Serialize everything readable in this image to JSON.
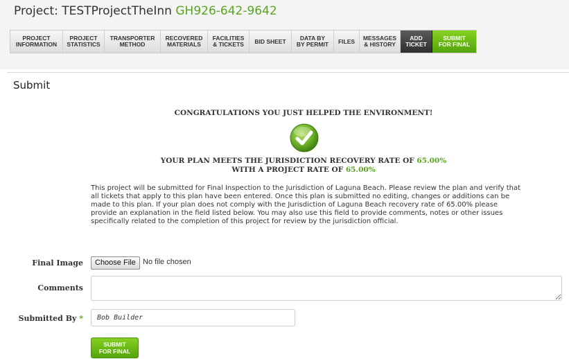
{
  "project": {
    "label": "Project: TESTProjectTheInn",
    "code": "GH926-642-9642"
  },
  "tabs": [
    {
      "label": "PROJECT\nINFORMATION"
    },
    {
      "label": "PROJECT\nSTATISTICS"
    },
    {
      "label": "TRANSPORTER\nMETHOD"
    },
    {
      "label": "RECOVERED\nMATERIALS"
    },
    {
      "label": "FACILITIES\n& TICKETS"
    },
    {
      "label": "BID SHEET"
    },
    {
      "label": "DATA BY\nBY PERMIT"
    },
    {
      "label": "FILES"
    },
    {
      "label": "MESSAGES\n& HISTORY"
    },
    {
      "label": "ADD\nTICKET"
    },
    {
      "label": "SUBMIT\nFOR FINAL"
    }
  ],
  "section": {
    "title": "Submit"
  },
  "message": {
    "congrats": "CONGRATULATIONS YOU JUST HELPED THE ENVIRONMENT!",
    "rate_line1_prefix": "YOUR PLAN MEETS THE JURISDICTION RECOVERY RATE OF",
    "rate_line1_value": "65.00%",
    "rate_line2_prefix": "WITH A PROJECT RATE OF",
    "rate_line2_value": "65.00%",
    "paragraph": "This project will be submitted for Final Inspection to the Jurisdiction of Laguna Beach. Please review the plan and verify that all tickets that apply to this plan have been entered. Once this plan is submitted no editing, changes or additions can be made to this plan. If your plan does not comply with the Jurisdiction of Laguna Beach recovery rate of 65.00% please provide an explanation in the field listed below. You may also use this field to provide comments, notes or other issues specifically related to the completion of this project for review by the jurisdiction official."
  },
  "form": {
    "final_image_label": "Final Image",
    "choose_file_label": "Choose File",
    "no_file_text": "No file chosen",
    "comments_label": "Comments",
    "comments_value": "",
    "submitted_by_label": "Submitted By",
    "required_mark": "*",
    "submitted_by_value": "Bob Builder",
    "submit_label": "SUBMIT\nFOR FINAL"
  },
  "colors": {
    "accent": "#5aa51e",
    "tab_dark": "#3a3a3a",
    "tab_green": "#6dbb17"
  }
}
